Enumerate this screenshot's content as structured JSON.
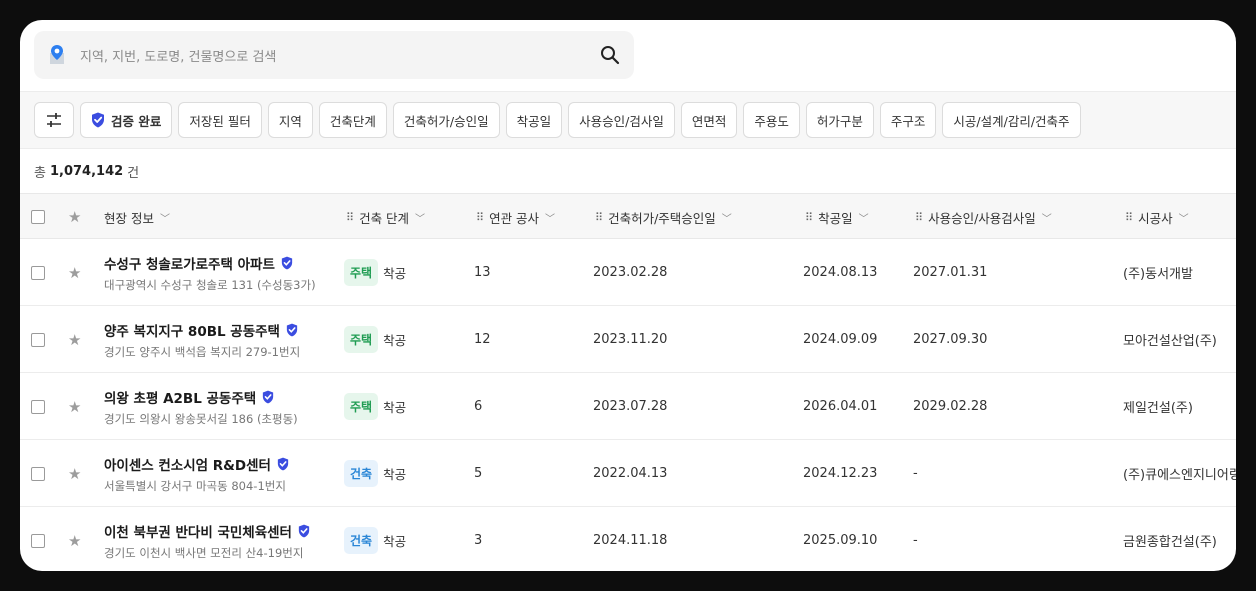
{
  "search": {
    "placeholder": "지역, 지번, 도로명, 건물명으로 검색"
  },
  "filters": {
    "verified_label": "검증 완료",
    "chips": [
      "저장된 필터",
      "지역",
      "건축단계",
      "건축허가/승인일",
      "착공일",
      "사용승인/검사일",
      "연면적",
      "주용도",
      "허가구분",
      "주구조",
      "시공/설계/감리/건축주"
    ]
  },
  "total": {
    "prefix": "총",
    "count": "1,074,142",
    "suffix": "건"
  },
  "table": {
    "columns": {
      "site": "현장 정보",
      "stage": "건축 단계",
      "related": "연관 공사",
      "permit": "건축허가/주택승인일",
      "start": "착공일",
      "approval": "사용승인/사용검사일",
      "builder": "시공사"
    },
    "rows": [
      {
        "name": "수성구 청솔로가로주택 아파트",
        "address": "대구광역시 수성구 청솔로 131 (수성동3가)",
        "badge": "주택",
        "badge_color": "#1f9c52",
        "stage": "착공",
        "related": "13",
        "permit": "2023.02.28",
        "start": "2024.08.13",
        "approval": "2027.01.31",
        "builder": "(주)동서개발"
      },
      {
        "name": "양주 복지지구 80BL 공동주택",
        "address": "경기도 양주시 백석읍 복지리 279-1번지",
        "badge": "주택",
        "badge_color": "#1f9c52",
        "stage": "착공",
        "related": "12",
        "permit": "2023.11.20",
        "start": "2024.09.09",
        "approval": "2027.09.30",
        "builder": "모아건설산업(주)"
      },
      {
        "name": "의왕 초평 A2BL 공동주택",
        "address": "경기도 의왕시 왕송못서길 186 (초평동)",
        "badge": "주택",
        "badge_color": "#1f9c52",
        "stage": "착공",
        "related": "6",
        "permit": "2023.07.28",
        "start": "2026.04.01",
        "approval": "2029.02.28",
        "builder": "제일건설(주)"
      },
      {
        "name": "아이센스 컨소시엄 R&D센터",
        "address": "서울특별시 강서구 마곡동 804-1번지",
        "badge": "건축",
        "badge_color": "#2a86d6",
        "stage": "착공",
        "related": "5",
        "permit": "2022.04.13",
        "start": "2024.12.23",
        "approval": "-",
        "builder": "(주)큐에스엔지니어링"
      },
      {
        "name": "이천 북부권 반다비 국민체육센터",
        "address": "경기도 이천시 백사면 모전리 산4-19번지",
        "badge": "건축",
        "badge_color": "#2a86d6",
        "stage": "착공",
        "related": "3",
        "permit": "2024.11.18",
        "start": "2025.09.10",
        "approval": "-",
        "builder": "금원종합건설(주)"
      }
    ]
  }
}
